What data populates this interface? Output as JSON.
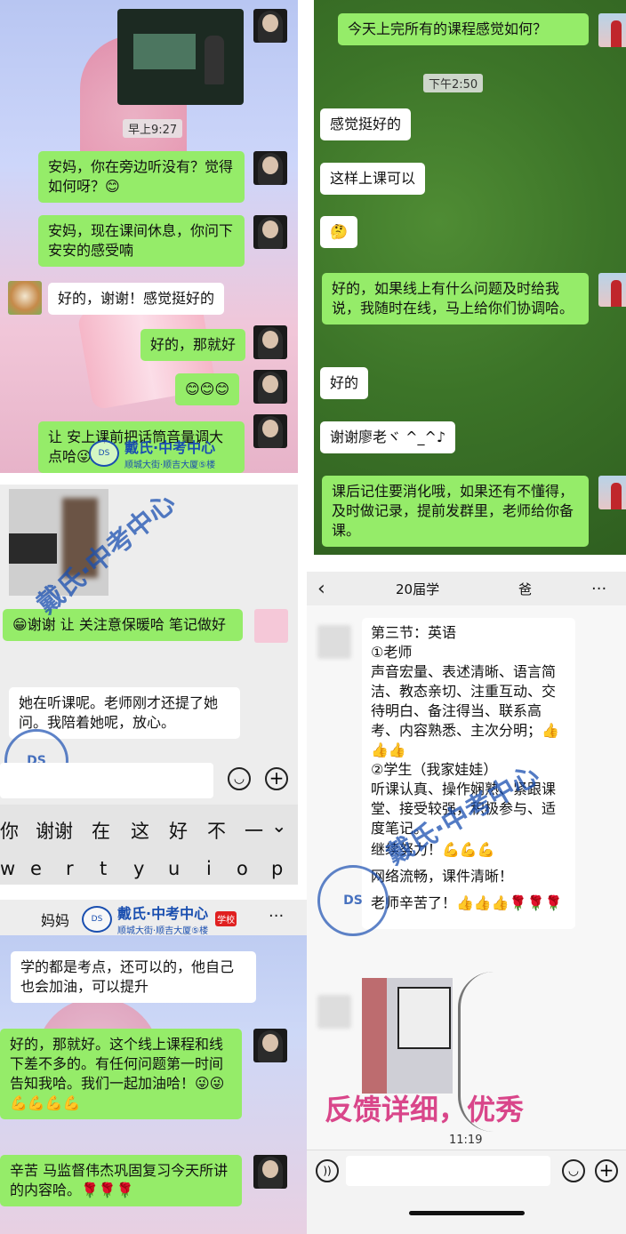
{
  "p1": {
    "timestamp": "早上9:27",
    "msg1": "安妈，你在旁边听没有？觉得如何呀？😊",
    "msg2": "安妈，现在课间休息，你问下安安的感受喃",
    "msg3": "好的，谢谢！感觉挺好的",
    "msg4": "好的，那就好",
    "msg5": "😊😊😊",
    "msg6": "让  安上课前把话筒音量调大点哈😜"
  },
  "p2": {
    "msg1": "今天上完所有的课程感觉如何？",
    "timestamp": "下午2:50",
    "msg2": "感觉挺好的",
    "msg3": "这样上课可以",
    "msg4": "🤔",
    "msg5": "好的，如果线上有什么问题及时给我说，我随时在线，马上给你们协调哈。",
    "msg6": "好的",
    "msg7": "谢谢廖老ヾ ^_^♪",
    "msg8": "课后记住要消化哦，如果还有不懂得，及时做记录，提前发群里，老师给你备课。"
  },
  "p3": {
    "msg1": "😁谢谢       让    关注意保暖哈  笔记做好",
    "msg2": "她在听课呢。老师刚才还提了她问。我陪着她呢，放心。",
    "keys_row1": [
      "你",
      "谢谢",
      "在",
      "这",
      "好",
      "不",
      "一"
    ],
    "keys_row2": [
      "w",
      "e",
      "r",
      "t",
      "y",
      "u",
      "i",
      "o",
      "p"
    ]
  },
  "p4": {
    "title": "20届学",
    "title_suffix": "爸",
    "more": "···",
    "msg_lines": [
      "第三节：英语",
      "①老师",
      "声音宏量、表述清晰、语言简洁、教态亲切、注重互动、交待明白、备注得当、联系高考、内容熟悉、主次分明；👍👍👍",
      "②学生（我家娃娃）",
      "听课认真、操作娴熟、紧跟课堂、接受较强，积极参与、适度笔记。",
      "继续努力！💪💪💪",
      "网络流畅，课件清晰！",
      "老师辛苦了！👍👍👍🌹🌹🌹"
    ],
    "caption": "反馈详细，优秀",
    "time": "11:19"
  },
  "p5": {
    "title": "妈妈",
    "more": "···",
    "msg1": "学的都是考点，还可以的，他自己也会加油，可以提升",
    "msg2": "好的，那就好。这个线上课程和线下差不多的。有任何问题第一时间告知我哈。我们一起加油哈！😜😜💪💪💪💪",
    "msg3": "辛苦     马监督伟杰巩固复习今天所讲的内容哈。🌹🌹🌹"
  },
  "watermark": {
    "main": "戴氏·中考中心",
    "sub": "顺城大街·顺吉大厦⑤楼",
    "badge": "学校",
    "logo": "DS",
    "big_main": "戴氏·中考中心",
    "big_sub": "顺城大街·顺吉大厦⑤楼"
  },
  "colors": {
    "green_bubble": "#95ec69",
    "field_green": "#3f7a2a",
    "chat_bg": "#ededed"
  },
  "icons": [
    "back-icon",
    "voice-icon",
    "emoji-icon",
    "plus-icon",
    "more-icon"
  ]
}
